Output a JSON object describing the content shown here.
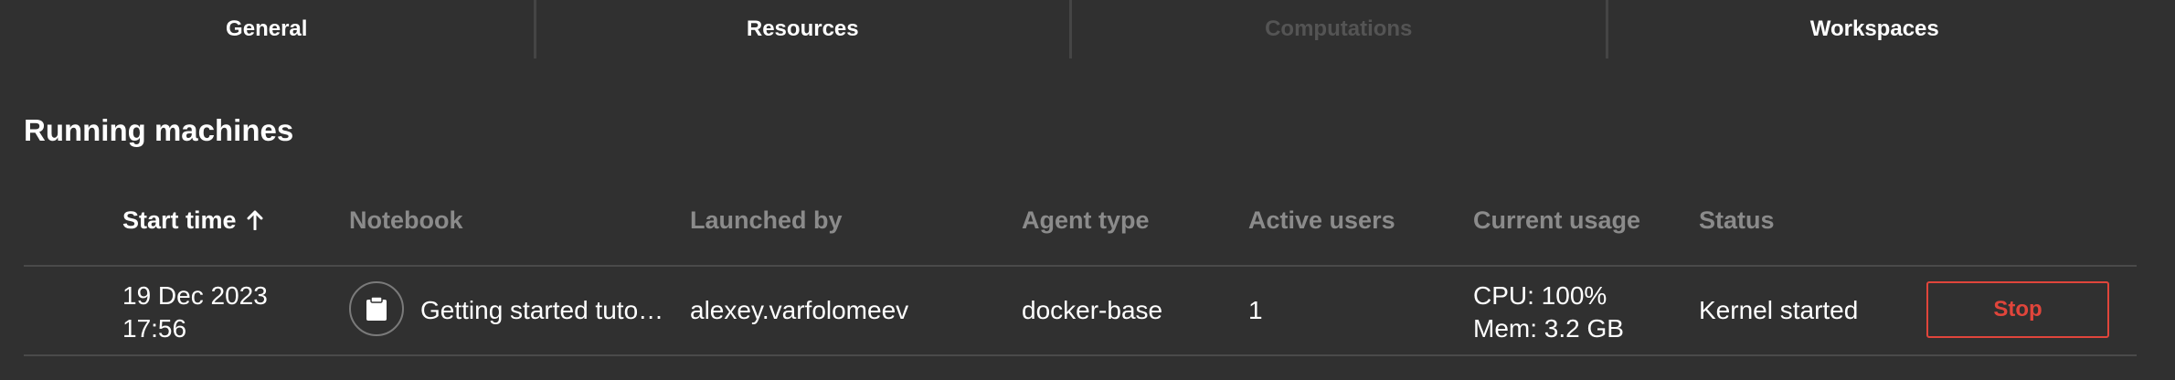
{
  "tabs": [
    {
      "label": "General",
      "disabled": false
    },
    {
      "label": "Resources",
      "disabled": false
    },
    {
      "label": "Computations",
      "disabled": true
    },
    {
      "label": "Workspaces",
      "disabled": false
    }
  ],
  "section": {
    "title": "Running machines"
  },
  "table": {
    "columns": {
      "start_time": "Start time",
      "notebook": "Notebook",
      "launched_by": "Launched by",
      "agent_type": "Agent type",
      "active_users": "Active users",
      "current_usage": "Current usage",
      "status": "Status"
    },
    "sort": {
      "column": "start_time",
      "direction": "ascending",
      "icon": "arrow-up-icon"
    },
    "rows": [
      {
        "start_date": "19 Dec 2023",
        "start_clock": "17:56",
        "notebook_icon": "clipboard-icon",
        "notebook": "Getting started tuto…",
        "launched_by": "alexey.varfolomeev",
        "agent_type": "docker-base",
        "active_users": "1",
        "cpu": "CPU: 100%",
        "mem": "Mem: 3.2 GB",
        "status": "Kernel started",
        "action": "Stop"
      }
    ]
  },
  "colors": {
    "background": "#303030",
    "divider": "#4a4a4a",
    "muted_text": "#8b8b8b",
    "danger": "#e0453b"
  }
}
